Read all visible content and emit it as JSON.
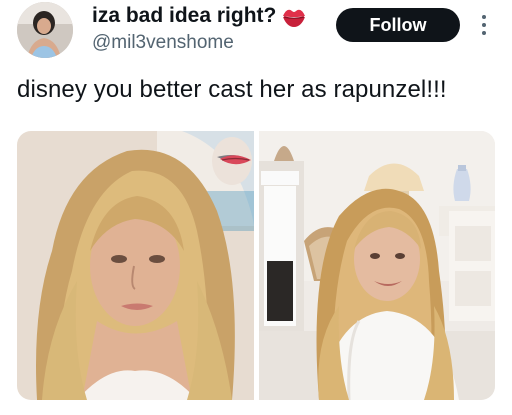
{
  "tweet": {
    "display_name": "iza bad idea right?",
    "handle": "@mil3venshome",
    "follow_label": "Follow",
    "text": "disney you better cast her as rapunzel!!!",
    "name_emoji_icon": "kiss-mark-icon",
    "more_icon": "more-vertical-icon"
  },
  "media": {
    "count": 2,
    "accent_colors": {
      "hair_blonde": "#d6b070",
      "lips_red": "#d9485a",
      "follow_bg": "#0f1419"
    }
  }
}
